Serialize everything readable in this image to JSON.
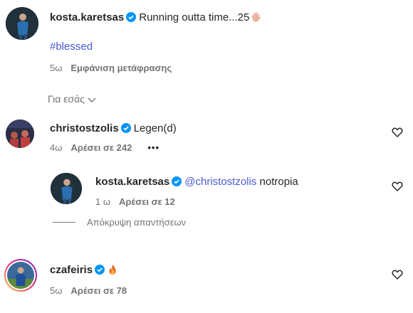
{
  "caption": {
    "username": "kosta.karetsas",
    "text": "Running outta time...25",
    "hand_emoji_name": "hand-icon",
    "hashtag": "#blessed",
    "time": "5ω",
    "translate": "Εμφάνιση μετάφρασης"
  },
  "sort_label": "Για εσάς",
  "comments": [
    {
      "username": "christostzolis",
      "text": "Legen(d)",
      "time": "4ω",
      "likes": "Αρέσει σε 242",
      "more": "•••"
    },
    {
      "username": "kosta.karetsas",
      "mention": "@christostzolis",
      "text": "notropia",
      "time": "1 ω",
      "likes": "Αρέσει σε 12"
    },
    {
      "username": "czafeiris",
      "text": "",
      "time": "5ω",
      "likes": "Αρέσει σε 78"
    }
  ],
  "hide_replies": "Απόκρυψη απαντήσεων",
  "colors": {
    "verified": "#0095f6",
    "link": "#4a5bd4",
    "muted": "#737373"
  }
}
